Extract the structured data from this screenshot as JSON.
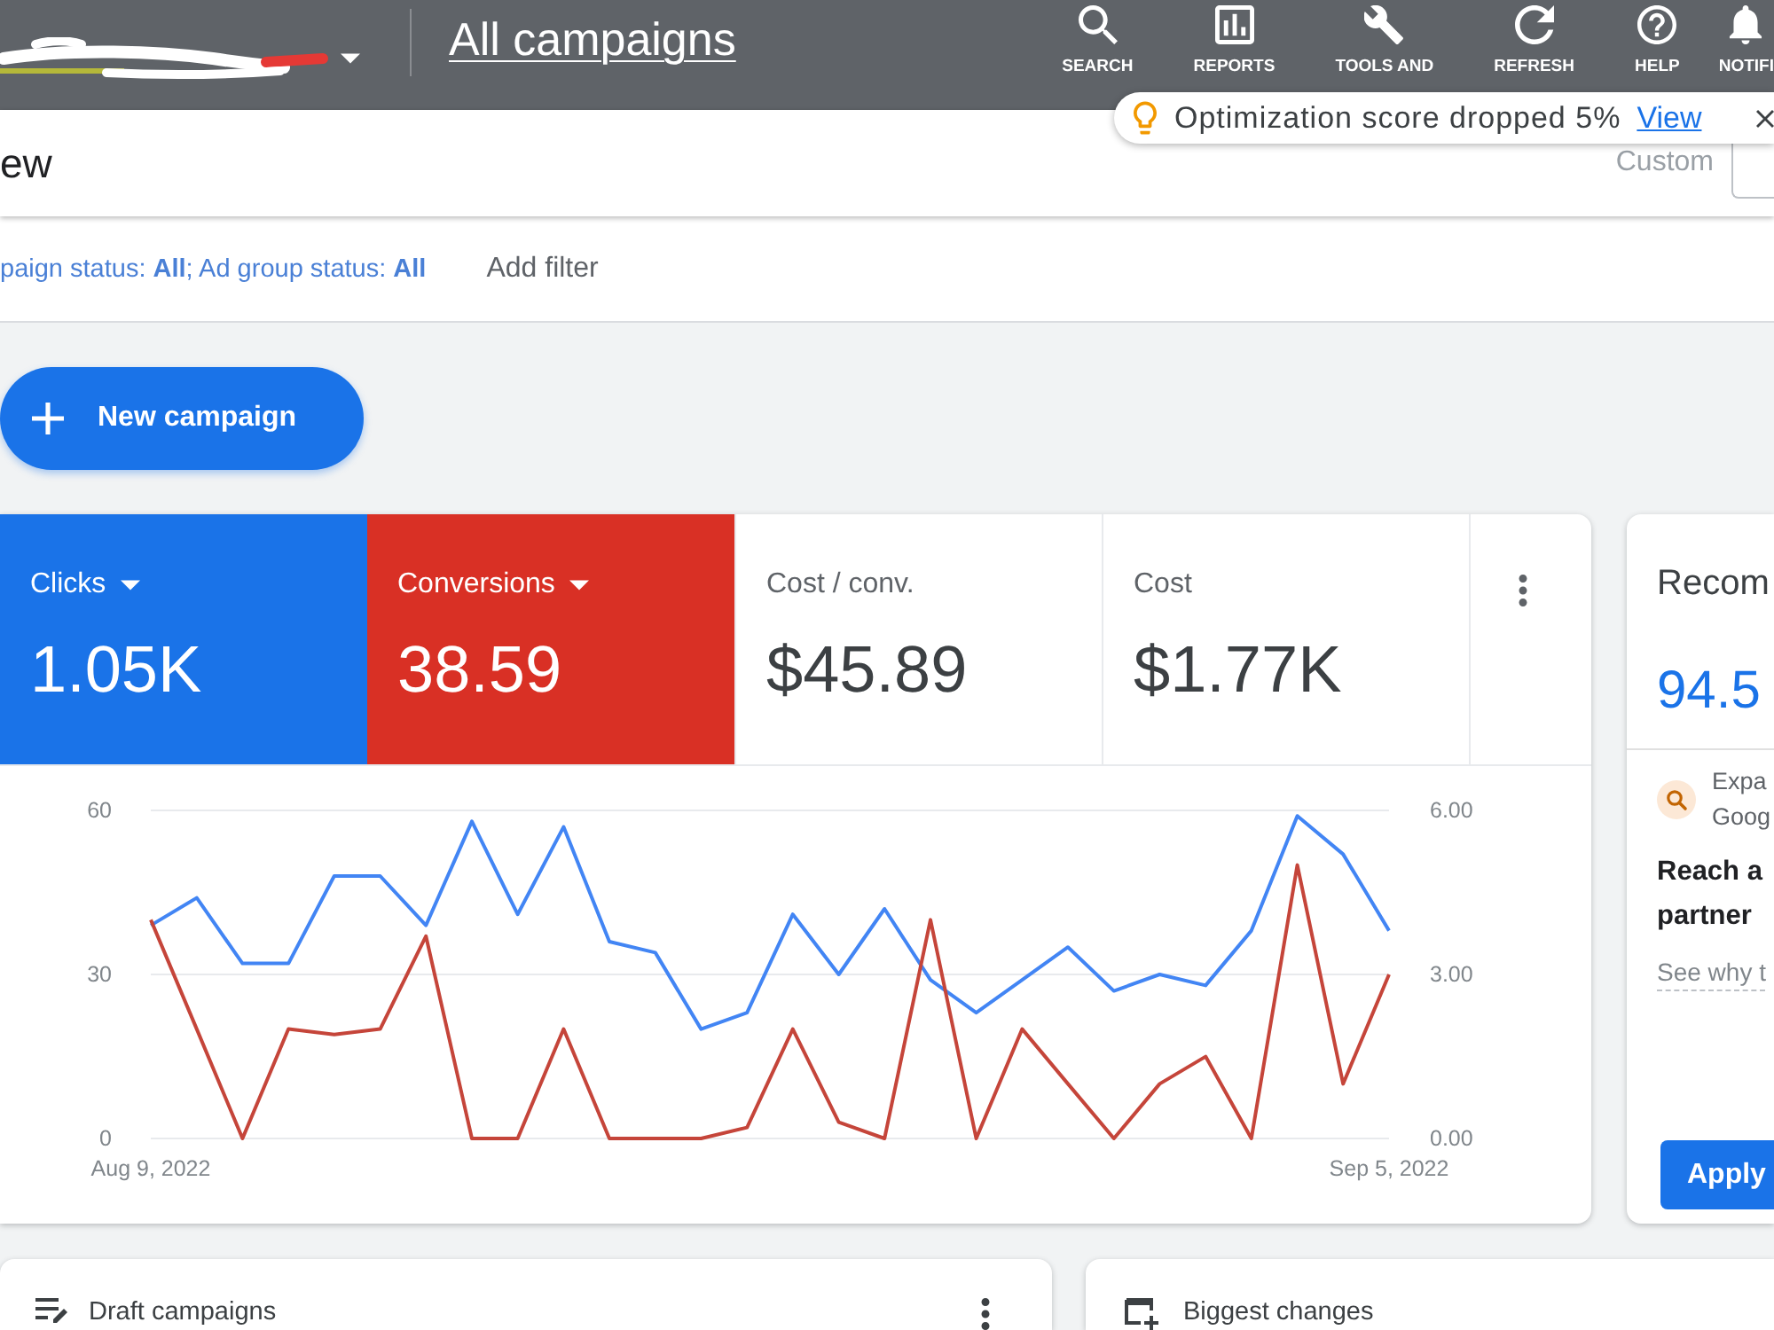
{
  "header": {
    "title": "All campaigns",
    "nav": [
      {
        "kind": "search",
        "label": "SEARCH"
      },
      {
        "kind": "reports",
        "label": "REPORTS"
      },
      {
        "kind": "tools",
        "label": "TOOLS AND"
      },
      {
        "kind": "refresh",
        "label": "REFRESH"
      },
      {
        "kind": "help",
        "label": "HELP"
      },
      {
        "kind": "notifications",
        "label": "NOTIFI"
      }
    ]
  },
  "toast": {
    "message": "Optimization score dropped 5%",
    "link": "View"
  },
  "page_bar": {
    "title": "ew",
    "date_preset": "Custom"
  },
  "filter_bar": {
    "filter": "paign status: **All**; Ad group status: **All**",
    "add_filter": "Add filter"
  },
  "new_campaign_button": "New campaign",
  "overview_card": {
    "metrics": [
      {
        "label": "Clicks",
        "value": "1.05K",
        "selected": true,
        "color": "#1a73e8"
      },
      {
        "label": "Conversions",
        "value": "38.59",
        "selected": true,
        "color": "#d93025"
      },
      {
        "label": "Cost / conv.",
        "value": "$45.89",
        "selected": false
      },
      {
        "label": "Cost",
        "value": "$1.77K",
        "selected": false
      }
    ],
    "chart_data": [
      {
        "type": "line",
        "x": [
          "2022-08-09",
          "2022-08-10",
          "2022-08-11",
          "2022-08-12",
          "2022-08-13",
          "2022-08-14",
          "2022-08-15",
          "2022-08-16",
          "2022-08-17",
          "2022-08-18",
          "2022-08-19",
          "2022-08-20",
          "2022-08-21",
          "2022-08-22",
          "2022-08-23",
          "2022-08-24",
          "2022-08-25",
          "2022-08-26",
          "2022-08-27",
          "2022-08-28",
          "2022-08-29",
          "2022-08-30",
          "2022-08-31",
          "2022-09-01",
          "2022-09-02",
          "2022-09-03",
          "2022-09-04",
          "2022-09-05"
        ],
        "series": [
          {
            "color": "#4285f4",
            "values": [
              39,
              44,
              32,
              32,
              48,
              48,
              39,
              58,
              41,
              57,
              36,
              34,
              20,
              23,
              41,
              30,
              42,
              29,
              23,
              29,
              35,
              27,
              30,
              28,
              38,
              59,
              52,
              38
            ]
          },
          {
            "color": "#c5453a",
            "axis": "y2",
            "values": [
              4,
              2,
              0,
              2,
              1.9,
              2,
              3.7,
              0,
              0,
              2,
              0,
              0,
              0,
              0.2,
              2,
              0.3,
              0,
              4,
              0,
              2,
              1,
              0,
              1,
              1.5,
              0,
              5,
              1,
              3
            ]
          }
        ],
        "xlim": [
          "2022-08-09",
          "2022-09-05"
        ],
        "ylim": [
          0,
          60
        ],
        "y2lim": [
          0,
          6
        ],
        "yticks": [
          0,
          30,
          60
        ],
        "y2ticks": [
          {
            "value": 0,
            "label": "0.00"
          },
          {
            "value": 3,
            "label": "3.00"
          },
          {
            "value": 6,
            "label": "6.00"
          }
        ],
        "xticks": [
          {
            "value": "2022-08-09",
            "label": "Aug 9, 2022"
          },
          {
            "value": "2022-09-05",
            "label": "Sep 5, 2022"
          }
        ],
        "grid": true
      }
    ]
  },
  "recommendations_card": {
    "title": "Recom",
    "score": "94.5",
    "item": {
      "description_lines": [
        "Expa",
        "Goog"
      ],
      "headline_lines": [
        "Reach a",
        "partner"
      ],
      "link": "See why t",
      "button": "Apply"
    }
  },
  "bottom_cards": [
    {
      "kind": "drafts",
      "title": "Draft campaigns"
    },
    {
      "kind": "changes",
      "title": "Biggest changes"
    }
  ]
}
